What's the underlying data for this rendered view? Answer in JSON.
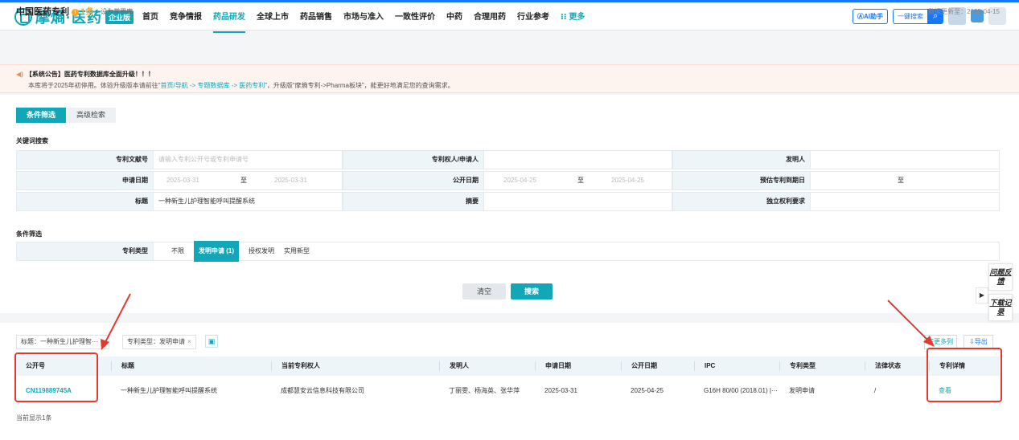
{
  "header": {
    "logo_text": "摩熵·医药",
    "logo_badge": "企业版",
    "nav": [
      "首页",
      "竞争情报",
      "药品研发",
      "全球上市",
      "药品销售",
      "市场与准入",
      "一致性评价",
      "中药",
      "合理用药",
      "行业参考"
    ],
    "nav_more": "更多",
    "ai_label": "AI助手",
    "quick_search": "一键搜索"
  },
  "subheader": {
    "title": "中国医药专利",
    "count": "1条",
    "favorite": "设为常用库",
    "updated": "数据更新至：2025-04-15"
  },
  "notice": {
    "line1": "【系统公告】医药专利数据库全面升级！！！",
    "l2_pre": "本库将于2025年初停用。体验升级版本请前往“",
    "l2_link": "首页/导航 -> 专题数据库 -> 医药专利",
    "l2_post": "”，升级版“摩熵专利->Pharma板块”，能更好地满足您的查询需求。"
  },
  "tabs": {
    "filter": "条件筛选",
    "advanced": "高级检索"
  },
  "keyword": {
    "section": "关键词搜索",
    "patent_no_label": "专利文献号",
    "patent_no_placeholder": "请输入专利公开号或专利申请号",
    "holder_label": "专利权人/申请人",
    "inventor_label": "发明人",
    "apply_date_label": "申请日期",
    "apply_from": "2025-03-31",
    "to": "至",
    "apply_to": "2025-03-31",
    "pub_date_label": "公开日期",
    "pub_from": "2025-04-25",
    "pub_to": "2025-04-25",
    "expire_label": "预估专利到期日",
    "title_label": "标题",
    "title_value": "一种新生儿护理智能呼叫提醒系统",
    "abstract_label": "摘要",
    "claim_label": "独立权利要求"
  },
  "conditions": {
    "section": "条件筛选",
    "type_label": "专利类型",
    "options": [
      "不限",
      "发明申请 (1)",
      "授权发明",
      "实用新型"
    ]
  },
  "buttons": {
    "clear": "清空",
    "search": "搜索"
  },
  "results": {
    "chip_title": "标题：一种新生儿护理智···",
    "chip_type": "专利类型：发明申请",
    "more_cols": "更多列",
    "export": "导出",
    "columns": [
      "公开号",
      "标题",
      "当前专利权人",
      "发明人",
      "申请日期",
      "公开日期",
      "IPC",
      "专利类型",
      "法律状态",
      "专利详情"
    ],
    "rows": [
      [
        "CN119889745A",
        "一种新生儿护理智能呼叫提醒系统",
        "成都慧安云信息科技有限公司",
        "丁丽雯、杨海英、张华萍",
        "2025-03-31",
        "2025-04-25",
        "G16H 80/00 (2018.01) |···",
        "发明申请",
        "/",
        "查看"
      ]
    ],
    "status": "当前显示1条"
  },
  "side": {
    "feedback": "问题反馈",
    "download": "下载记录"
  },
  "colors": {
    "accent": "#11a7b8",
    "blue": "#1677ff",
    "annotation": "#e23b2e"
  }
}
